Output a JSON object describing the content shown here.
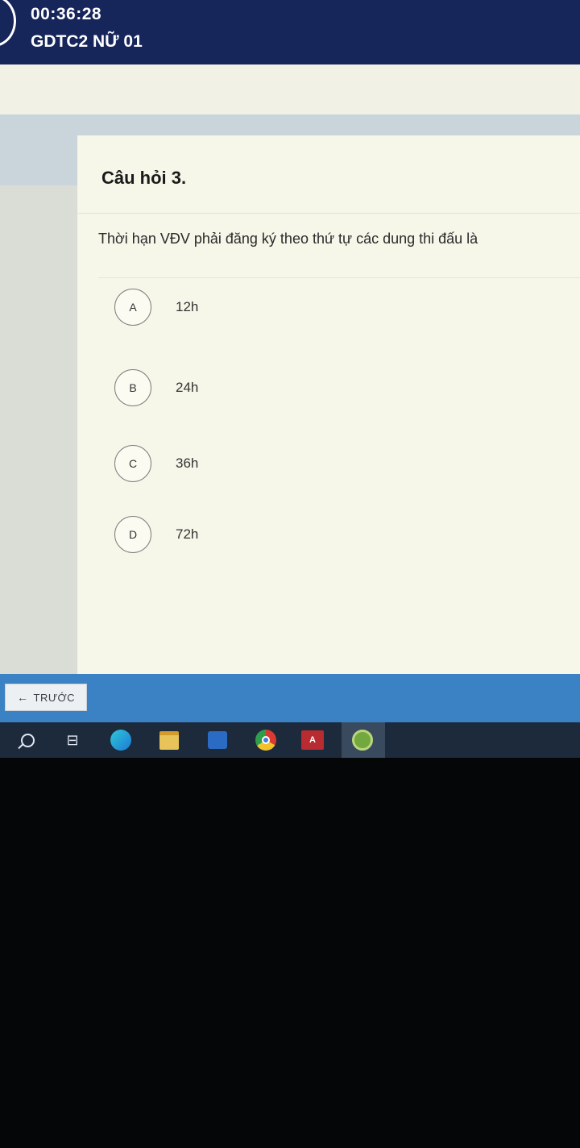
{
  "header": {
    "timer": "00:36:28",
    "exam_title": "GDTC2 NỮ 01"
  },
  "question": {
    "number_label": "Câu hỏi 3.",
    "text": "Thời hạn VĐV phải đăng ký theo thứ tự các dung thi đấu là",
    "options": [
      {
        "letter": "A",
        "text": "12h"
      },
      {
        "letter": "B",
        "text": "24h"
      },
      {
        "letter": "C",
        "text": "36h"
      },
      {
        "letter": "D",
        "text": "72h"
      }
    ]
  },
  "nav": {
    "prev_arrow": "←",
    "prev_label": "TRƯỚC"
  },
  "taskbar": {
    "task_view_glyph": "⊟",
    "access_label": "A"
  },
  "colors": {
    "header_bg": "#16255a",
    "nav_bg": "#3b82c4",
    "card_bg": "#f6f6e9"
  },
  "icons": [
    "search-icon",
    "task-view-icon",
    "edge-icon",
    "file-explorer-icon",
    "store-icon",
    "chrome-icon",
    "access-icon",
    "app-icon"
  ]
}
